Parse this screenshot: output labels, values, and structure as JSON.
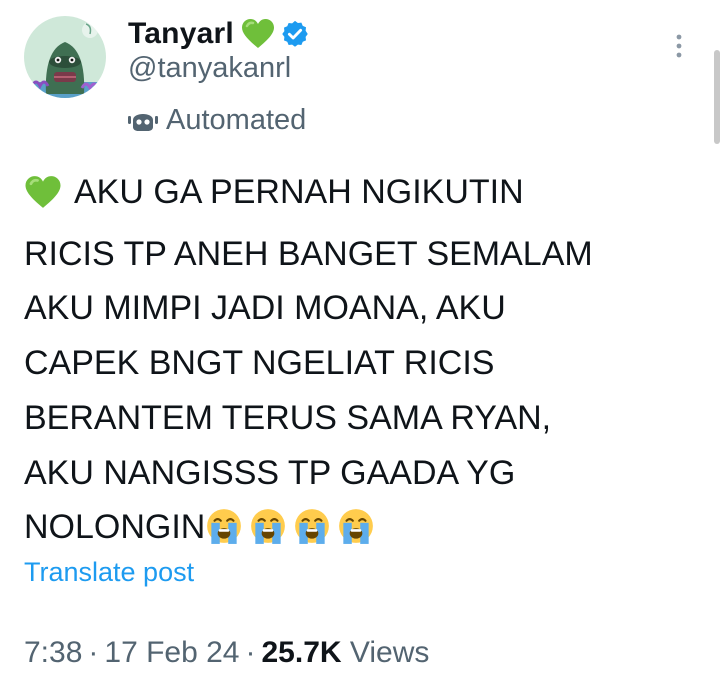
{
  "colors": {
    "text_primary": "#0f1419",
    "text_secondary": "#536471",
    "link_blue": "#1d9bf0",
    "verified_blue": "#1d9bf0",
    "heart_green": "#6fbf3a"
  },
  "author": {
    "display_name": "Tanyarl",
    "name_emoji": "green-heart-icon",
    "verified_badge": "verified-badge-icon",
    "handle": "@tanyakanrl",
    "automated_icon": "bot-icon",
    "automated_label": "Automated",
    "avatar": "avatar"
  },
  "menu": {
    "more_icon": "more-vertical-icon"
  },
  "tweet": {
    "lead_emoji": "green-heart-icon",
    "lines": [
      "AKU GA PERNAH NGIKUTIN",
      "RICIS TP ANEH BANGET SEMALAM",
      "AKU MIMPI JADI MOANA, AKU",
      "CAPEK BNGT NGELIAT RICIS",
      "BERANTEM TERUS SAMA RYAN,",
      "AKU NANGISSS TP GAADA YG",
      "NOLONGIN"
    ],
    "trailing_emojis": [
      "crying-face-icon",
      "crying-face-icon",
      "crying-face-icon",
      "crying-face-icon"
    ],
    "translate_label": "Translate post"
  },
  "meta": {
    "time": "7:38",
    "separator": "·",
    "date": "17 Feb 24",
    "views_count": "25.7K",
    "views_label": "Views"
  }
}
